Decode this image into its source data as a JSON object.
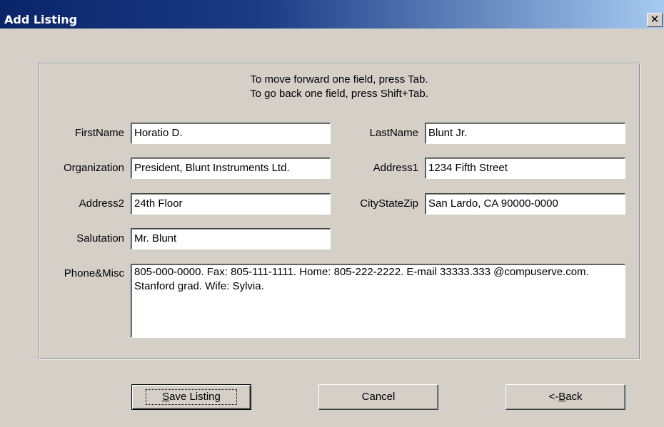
{
  "window": {
    "title": "Add Listing",
    "close_glyph": "✕",
    "close_icon": "close-icon"
  },
  "instructions": {
    "line1": "To move forward one field, press Tab.",
    "line2": "To go back one field, press Shift+Tab."
  },
  "fields": {
    "firstname": {
      "label": "FirstName",
      "value": "Horatio D."
    },
    "lastname": {
      "label": "LastName",
      "value": "Blunt Jr."
    },
    "organization": {
      "label": "Organization",
      "value": "President, Blunt Instruments Ltd."
    },
    "address1": {
      "label": "Address1",
      "value": "1234 Fifth Street"
    },
    "address2": {
      "label": "Address2",
      "value": "24th Floor"
    },
    "citystatezip": {
      "label": "CityStateZip",
      "value": "San Lardo, CA 90000-0000"
    },
    "salutation": {
      "label": "Salutation",
      "value": "Mr. Blunt"
    },
    "phonemisc": {
      "label": "Phone&Misc",
      "value": "805-000-0000.  Fax: 805-111-1111.  Home: 805-222-2222.  E-mail 33333.333 @compuserve.com.  Stanford grad.  Wife: Sylvia."
    }
  },
  "buttons": {
    "save": {
      "pre": "",
      "mnemonic": "S",
      "post": "ave Listing"
    },
    "cancel": {
      "label": "Cancel"
    },
    "back": {
      "pre": "<-",
      "mnemonic": "B",
      "post": "ack"
    }
  },
  "colors": {
    "titlebar_start": "#0a246a",
    "titlebar_end": "#a6caf0",
    "face": "#d4d0c8"
  }
}
